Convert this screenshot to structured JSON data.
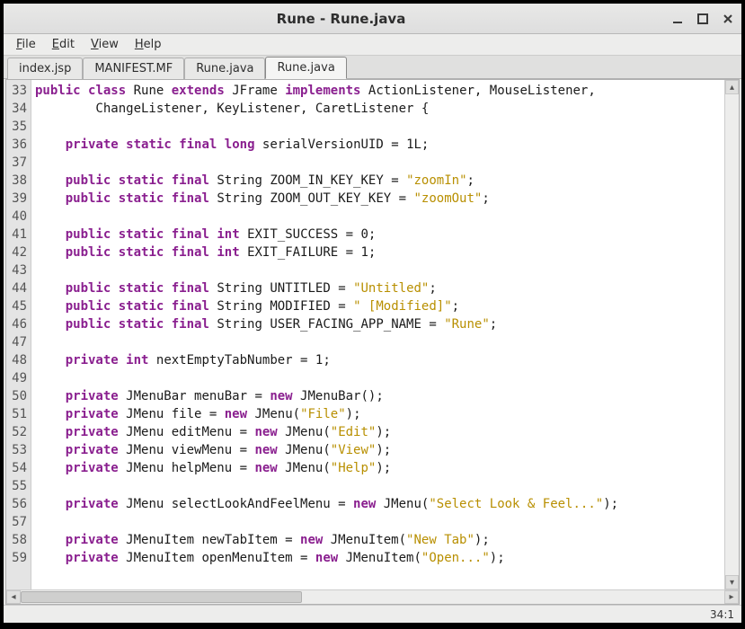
{
  "window": {
    "title": "Rune - Rune.java"
  },
  "menubar": {
    "items": [
      {
        "label": "File",
        "accel": "F"
      },
      {
        "label": "Edit",
        "accel": "E"
      },
      {
        "label": "View",
        "accel": "V"
      },
      {
        "label": "Help",
        "accel": "H"
      }
    ]
  },
  "tabs": {
    "items": [
      {
        "label": "index.jsp"
      },
      {
        "label": "MANIFEST.MF"
      },
      {
        "label": "Rune.java"
      },
      {
        "label": "Rune.java"
      }
    ],
    "activeIndex": 3
  },
  "editor": {
    "firstLine": 33,
    "lines": [
      "public class Rune extends JFrame implements ActionListener, MouseListener,",
      "        ChangeListener, KeyListener, CaretListener {",
      "",
      "    private static final long serialVersionUID = 1L;",
      "",
      "    public static final String ZOOM_IN_KEY_KEY = \"zoomIn\";",
      "    public static final String ZOOM_OUT_KEY_KEY = \"zoomOut\";",
      "",
      "    public static final int EXIT_SUCCESS = 0;",
      "    public static final int EXIT_FAILURE = 1;",
      "",
      "    public static final String UNTITLED = \"Untitled\";",
      "    public static final String MODIFIED = \" [Modified]\";",
      "    public static final String USER_FACING_APP_NAME = \"Rune\";",
      "",
      "    private int nextEmptyTabNumber = 1;",
      "",
      "    private JMenuBar menuBar = new JMenuBar();",
      "    private JMenu file = new JMenu(\"File\");",
      "    private JMenu editMenu = new JMenu(\"Edit\");",
      "    private JMenu viewMenu = new JMenu(\"View\");",
      "    private JMenu helpMenu = new JMenu(\"Help\");",
      "",
      "    private JMenu selectLookAndFeelMenu = new JMenu(\"Select Look & Feel...\");",
      "",
      "    private JMenuItem newTabItem = new JMenuItem(\"New Tab\");",
      "    private JMenuItem openMenuItem = new JMenuItem(\"Open...\");"
    ]
  },
  "status": {
    "position": "34:1"
  },
  "colors": {
    "keyword": "#8a1f8f",
    "string": "#b88f00"
  }
}
